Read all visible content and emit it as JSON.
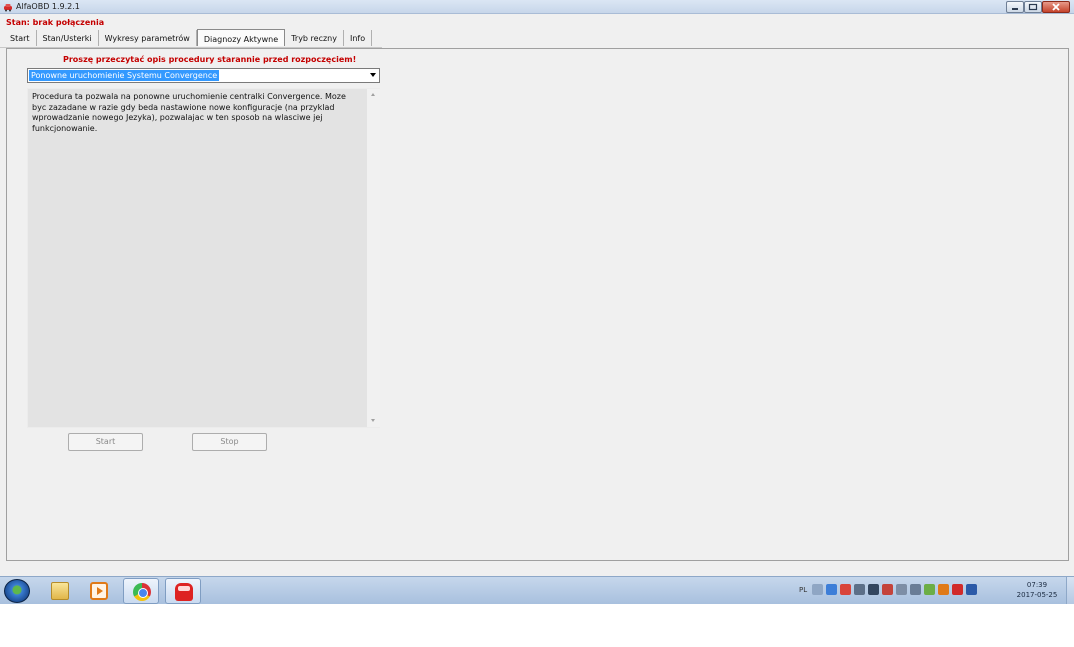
{
  "window": {
    "title": "AlfaOBD 1.9.2.1",
    "app_icon": "alfaobd-car-icon",
    "controls": [
      "minimize-icon",
      "maximize-icon",
      "close-icon"
    ]
  },
  "status": {
    "text": "Stan: brak połączenia",
    "color": "#c40000"
  },
  "tabs": [
    {
      "label": "Start",
      "active": false
    },
    {
      "label": "Stan/Usterki",
      "active": false
    },
    {
      "label": "Wykresy parametrów",
      "active": false
    },
    {
      "label": "Diagnozy Aktywne",
      "active": true
    },
    {
      "label": "Tryb reczny",
      "active": false
    },
    {
      "label": "Info",
      "active": false
    }
  ],
  "panel": {
    "warning": "Proszę przeczytać opis procedury starannie przed rozpoczęciem!",
    "procedure_select": {
      "value": "Ponowne uruchomienie Systemu Convergence"
    },
    "description": "Procedura ta pozwala na ponowne uruchomienie centralki Convergence. Moze byc zazadane w razie gdy beda nastawione nowe konfiguracje (na przyklad wprowadzanie nowego Jezyka), pozwalajac w ten sposob na wlasciwe jej funkcjonowanie.",
    "buttons": {
      "start": "Start",
      "stop": "Stop"
    }
  },
  "taskbar": {
    "items": [
      "start-orb-icon",
      "folder-icon",
      "media-player-icon",
      "chrome-icon",
      "alfaobd-car-icon"
    ],
    "language": "PL",
    "clock": {
      "time": "07:39",
      "date": "2017-05-25"
    }
  },
  "colors": {
    "accent": "#3399ff",
    "warning": "#c40000"
  }
}
